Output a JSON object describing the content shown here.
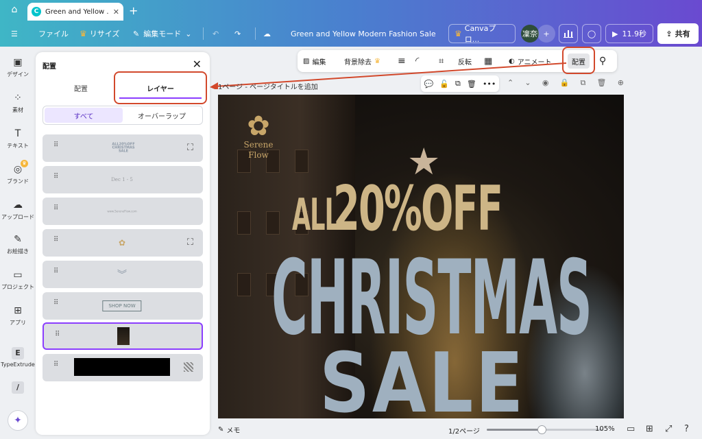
{
  "tabs": [
    {
      "title": "Green and Yellow ...",
      "favicon": "C"
    }
  ],
  "topbar": {
    "file": "ファイル",
    "resize": "リサイズ",
    "edit_mode": "編集モード",
    "doc_title": "Green and Yellow Modern Fashion Sale Em...",
    "canva_pro": "Canvaプロ...",
    "avatar": "凜奈",
    "play_time": "11.9秒",
    "share": "共有"
  },
  "sidebar": {
    "items": [
      {
        "label": "デザイン",
        "icon": "design-icon"
      },
      {
        "label": "素材",
        "icon": "elements-icon"
      },
      {
        "label": "テキスト",
        "icon": "text-icon"
      },
      {
        "label": "ブランド",
        "icon": "brand-icon"
      },
      {
        "label": "アップロード",
        "icon": "upload-icon"
      },
      {
        "label": "お絵描き",
        "icon": "draw-icon"
      },
      {
        "label": "プロジェクト",
        "icon": "projects-icon"
      },
      {
        "label": "アプリ",
        "icon": "apps-icon"
      },
      {
        "label": "TypeExtrude",
        "icon": "typeextrude-icon"
      }
    ]
  },
  "panel": {
    "title": "配置",
    "tab_arrange": "配置",
    "tab_layer": "レイヤー",
    "filter_all": "すべて",
    "filter_overlap": "オーバーラップ",
    "layers": [
      {
        "name": "headline-text",
        "thumb": "ALL 20% OFF CHRISTMAS SALE"
      },
      {
        "name": "date-text",
        "thumb": "Dec 1 - 5"
      },
      {
        "name": "website-text",
        "thumb": "www.SereneFlow.com"
      },
      {
        "name": "logo",
        "thumb": "Serene Flow"
      },
      {
        "name": "chevron-graphic",
        "thumb": ""
      },
      {
        "name": "shop-now-button",
        "thumb": "SHOP NOW"
      },
      {
        "name": "background-photo",
        "thumb": ""
      },
      {
        "name": "background-color",
        "thumb": ""
      }
    ]
  },
  "context_toolbar": {
    "edit": "編集",
    "remove_bg": "背景除去",
    "flip": "反転",
    "animate": "アニメート",
    "arrange": "配置"
  },
  "canvas": {
    "page_label": "1ページ - ページタイトルを追加",
    "logo_name_line1": "Serene",
    "logo_name_line2": "Flow",
    "headline_all": "ALL",
    "headline_offer": "20%OFF",
    "headline_christmas": "CHRISTMAS",
    "headline_sale": "SALE"
  },
  "bottombar": {
    "memo": "メモ",
    "pages": "1/2ページ",
    "zoom": "105%",
    "zoom_fraction": 0.47
  },
  "colors": {
    "accent": "#8b3dff",
    "highlight": "#d2482b",
    "gold": "#cdb586",
    "steel": "#9fb0bf"
  }
}
